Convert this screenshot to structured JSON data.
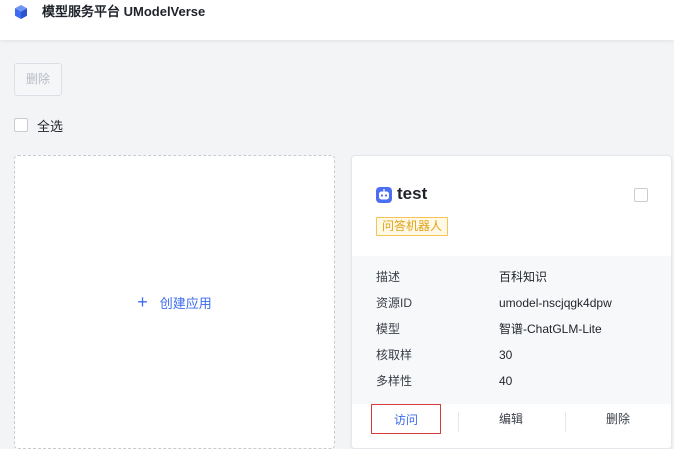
{
  "header": {
    "title": "模型服务平台 UModelVerse",
    "logo_icon": "cube-icon",
    "accent_color": "#3b6bf0"
  },
  "toolbar": {
    "delete_label": "删除"
  },
  "select_all": {
    "label": "全选"
  },
  "create_card": {
    "plus": "+",
    "label": "创建应用"
  },
  "app_card": {
    "icon": "bot-icon",
    "name": "test",
    "tag": "问答机器人",
    "details": [
      {
        "key": "描述",
        "value": "百科知识"
      },
      {
        "key": "资源ID",
        "value": "umodel-nscjqgk4dpw"
      },
      {
        "key": "模型",
        "value": "智谱-ChatGLM-Lite"
      },
      {
        "key": "核取样",
        "value": "30"
      },
      {
        "key": "多样性",
        "value": "40"
      }
    ],
    "actions": {
      "visit": "访问",
      "edit": "编辑",
      "delete": "删除"
    }
  }
}
